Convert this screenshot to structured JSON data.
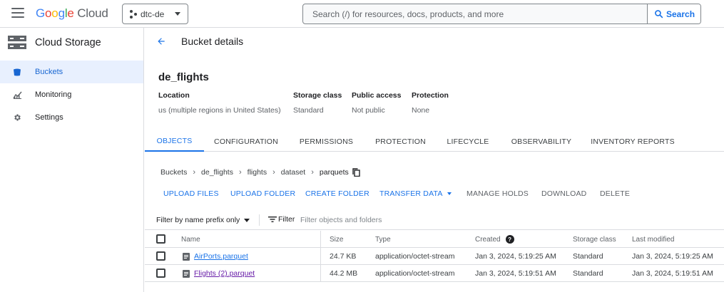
{
  "header": {
    "logo_google": [
      "G",
      "o",
      "o",
      "g",
      "l",
      "e"
    ],
    "logo_cloud": "Cloud",
    "project": "dtc-de",
    "search_placeholder": "Search (/) for resources, docs, products, and more",
    "search_button": "Search"
  },
  "sidebar": {
    "product": "Cloud Storage",
    "items": [
      {
        "label": "Buckets",
        "icon": "bucket-icon",
        "active": true
      },
      {
        "label": "Monitoring",
        "icon": "chart-icon",
        "active": false
      },
      {
        "label": "Settings",
        "icon": "gear-icon",
        "active": false
      }
    ]
  },
  "page": {
    "title": "Bucket details",
    "bucket_name": "de_flights",
    "meta": [
      {
        "key": "Location",
        "value": "us (multiple regions in United States)"
      },
      {
        "key": "Storage class",
        "value": "Standard"
      },
      {
        "key": "Public access",
        "value": "Not public"
      },
      {
        "key": "Protection",
        "value": "None"
      }
    ],
    "tabs": [
      "OBJECTS",
      "CONFIGURATION",
      "PERMISSIONS",
      "PROTECTION",
      "LIFECYCLE",
      "OBSERVABILITY",
      "INVENTORY REPORTS"
    ],
    "active_tab": "OBJECTS",
    "breadcrumb": [
      "Buckets",
      "de_flights",
      "flights",
      "dataset",
      "parquets"
    ],
    "actions": [
      "UPLOAD FILES",
      "UPLOAD FOLDER",
      "CREATE FOLDER",
      "TRANSFER DATA",
      "MANAGE HOLDS",
      "DOWNLOAD",
      "DELETE"
    ],
    "filter_prefix": "Filter by name prefix only",
    "filter_label": "Filter",
    "filter_placeholder": "Filter objects and folders"
  },
  "table": {
    "columns": [
      "Name",
      "Size",
      "Type",
      "Created",
      "Storage class",
      "Last modified"
    ],
    "rows": [
      {
        "name": "AirPorts.parquet",
        "size": "24.7 KB",
        "type": "application/octet-stream",
        "created": "Jan 3, 2024, 5:19:25 AM",
        "storage_class": "Standard",
        "last_modified": "Jan 3, 2024, 5:19:25 AM"
      },
      {
        "name": "Flights (2).parquet",
        "size": "44.2 MB",
        "type": "application/octet-stream",
        "created": "Jan 3, 2024, 5:19:51 AM",
        "storage_class": "Standard",
        "last_modified": "Jan 3, 2024, 5:19:51 AM"
      }
    ]
  },
  "colors": {
    "accent": "#1a73e8",
    "active_bg": "#e8f0fe",
    "visited_link": "#681da8"
  }
}
